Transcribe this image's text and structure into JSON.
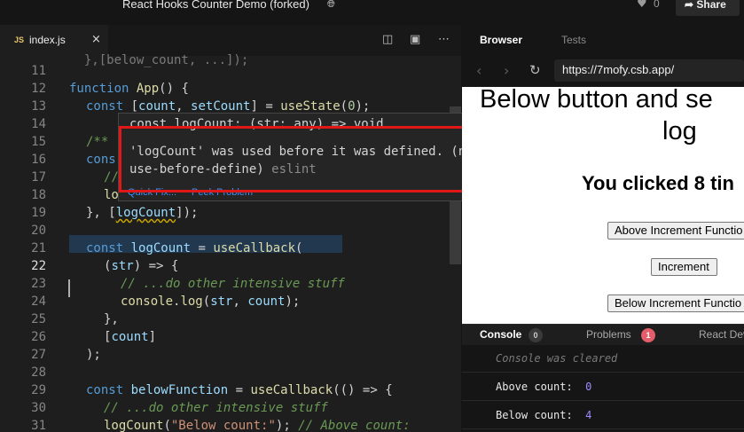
{
  "app": {
    "title": "React Hooks Counter Demo (forked)",
    "likes": "0",
    "share_label": "Share"
  },
  "editor": {
    "tab": {
      "badge": "JS",
      "filename": "index.js",
      "close": "×"
    },
    "icons": [
      "split-editor-icon",
      "preview-icon",
      "more-icon"
    ],
    "line_numbers": [
      "11",
      "12",
      "13",
      "14",
      "15",
      "16",
      "17",
      "18",
      "19",
      "20",
      "21",
      "22",
      "23",
      "24",
      "25",
      "26",
      "27",
      "28",
      "29",
      "30",
      "31"
    ],
    "active_line": "22",
    "code": {
      "l11": "  },[below_count, ...]);",
      "l12_kw": "function",
      "l12_fn": "App",
      "l12_rest": "() {",
      "l13_kw": "const",
      "l13_a": " [",
      "l13_v1": "count",
      "l13_c": ", ",
      "l13_v2": "setCount",
      "l13_b": "] = ",
      "l13_fn": "useState",
      "l13_p1": "(",
      "l13_num": "0",
      "l13_p2": ");",
      "l15": "/**",
      "l16": "cons",
      "l17": "//",
      "l18": "lo",
      "l19_a": "}, [",
      "l19_v": "logCount",
      "l19_b": "]);",
      "l21_kw": "const",
      "l21_v": "logCount",
      "l21_a": " = ",
      "l21_fn": "useCallback",
      "l21_b": "(",
      "l22_a": "(",
      "l22_v": "str",
      "l22_b": ") => {",
      "l23": "// ...do other intensive stuff",
      "l24_v": "console",
      "l24_a": ".",
      "l24_fn": "log",
      "l24_b": "(",
      "l24_v2": "str",
      "l24_c": ", ",
      "l24_v3": "count",
      "l24_d": ");",
      "l25": "},",
      "l26_a": "[",
      "l26_v": "count",
      "l26_b": "]",
      "l27": ");",
      "l29_kw": "const",
      "l29_v": "belowFunction",
      "l29_a": " = ",
      "l29_fn": "useCallback",
      "l29_b": "(() => {",
      "l30": "// ...do other intensive stuff",
      "l31_fn": "logCount",
      "l31_a": "(",
      "l31_str": "\"Below count:\"",
      "l31_b": "); ",
      "l31_cm": "// Above count:"
    },
    "hover": {
      "signature": "const logCount: (str: any) => void",
      "message_line1": "'logCount' was used before it was defined. (no-",
      "message_line2": "use-before-define)",
      "source": "eslint",
      "quick_fix": "Quick Fix...",
      "peek_problem": "Peek Problem"
    }
  },
  "browser": {
    "tabs": [
      "Browser",
      "Tests"
    ],
    "url": "https://7mofy.csb.app/",
    "preview": {
      "heading_line1": "Below button and se",
      "heading_line2": "log",
      "clicked_text": "You clicked 8 tin",
      "buttons": [
        "Above Increment Functio",
        "Increment",
        "Below Increment Functio"
      ]
    },
    "console_tabs": {
      "console": "Console",
      "console_count": "0",
      "problems": "Problems",
      "problems_count": "1",
      "react": "React Dev"
    },
    "console_lines": {
      "cleared": "Console was cleared",
      "above_label": "Above count:",
      "above_value": "0",
      "below_label": "Below count:",
      "below_value": "4"
    }
  }
}
